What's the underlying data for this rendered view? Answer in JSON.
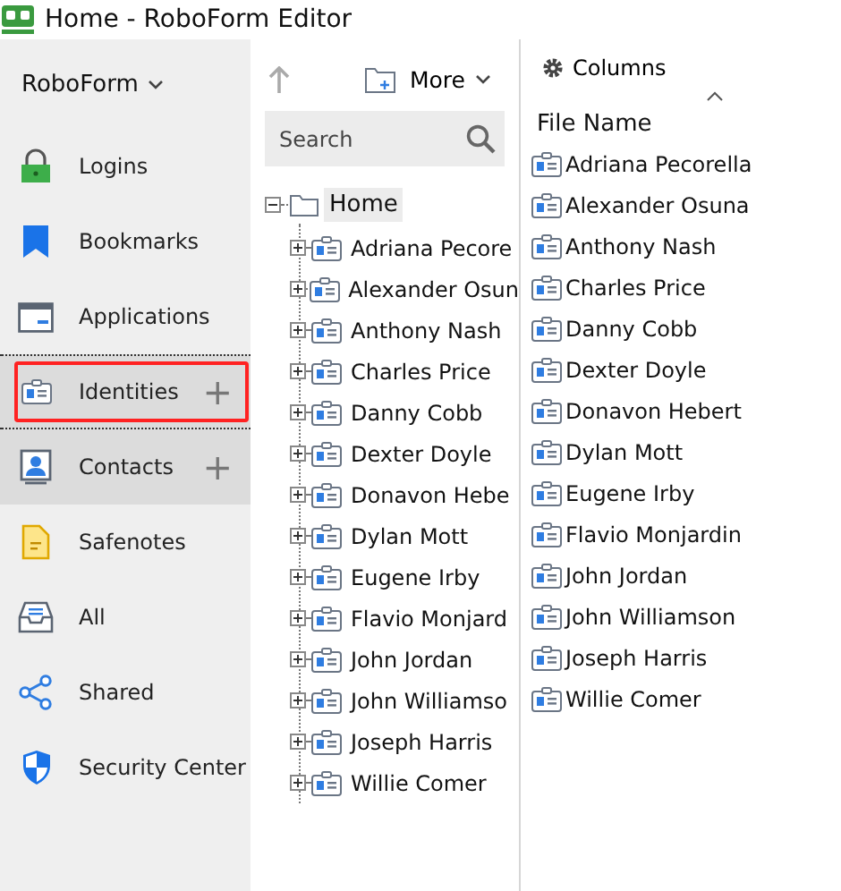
{
  "window": {
    "title": "Home - RoboForm Editor"
  },
  "sidebar": {
    "account": "RoboForm",
    "items": [
      {
        "kind": "logins",
        "label": "Logins",
        "selected": false,
        "hovered": false,
        "add_button": false,
        "annotated": false
      },
      {
        "kind": "bookmarks",
        "label": "Bookmarks",
        "selected": false,
        "hovered": false,
        "add_button": false,
        "annotated": false
      },
      {
        "kind": "applications",
        "label": "Applications",
        "selected": false,
        "hovered": false,
        "add_button": false,
        "annotated": false
      },
      {
        "kind": "identities",
        "label": "Identities",
        "selected": true,
        "hovered": false,
        "add_button": "+",
        "annotated": true
      },
      {
        "kind": "contacts",
        "label": "Contacts",
        "selected": false,
        "hovered": true,
        "add_button": "+",
        "annotated": false
      },
      {
        "kind": "safenotes",
        "label": "Safenotes",
        "selected": false,
        "hovered": false,
        "add_button": false,
        "annotated": false
      },
      {
        "kind": "all",
        "label": "All",
        "selected": false,
        "hovered": false,
        "add_button": false,
        "annotated": false
      },
      {
        "kind": "shared",
        "label": "Shared",
        "selected": false,
        "hovered": false,
        "add_button": false,
        "annotated": false
      },
      {
        "kind": "security",
        "label": "Security Center",
        "selected": false,
        "hovered": false,
        "add_button": false,
        "annotated": false
      }
    ]
  },
  "toolbar": {
    "more": "More"
  },
  "search": {
    "placeholder": "Search"
  },
  "tree": {
    "label": "Home",
    "expanded": true,
    "children": [
      {
        "label": "Adriana Pecore",
        "expanded": false
      },
      {
        "label": "Alexander Osun",
        "expanded": false
      },
      {
        "label": "Anthony Nash",
        "expanded": false
      },
      {
        "label": "Charles Price",
        "expanded": false
      },
      {
        "label": "Danny Cobb",
        "expanded": false
      },
      {
        "label": "Dexter Doyle",
        "expanded": false
      },
      {
        "label": "Donavon Hebe",
        "expanded": false
      },
      {
        "label": "Dylan Mott",
        "expanded": false
      },
      {
        "label": "Eugene Irby",
        "expanded": false
      },
      {
        "label": "Flavio Monjard",
        "expanded": false
      },
      {
        "label": "John Jordan",
        "expanded": false
      },
      {
        "label": "John Williamso",
        "expanded": false
      },
      {
        "label": "Joseph Harris",
        "expanded": false
      },
      {
        "label": "Willie Comer",
        "expanded": false
      }
    ]
  },
  "file_list": {
    "columns_button": "Columns",
    "column": "File Name",
    "rows": [
      "Adriana Pecorella",
      "Alexander Osuna",
      "Anthony Nash",
      "Charles Price",
      "Danny Cobb",
      "Dexter Doyle",
      "Donavon Hebert",
      "Dylan Mott",
      "Eugene Irby",
      "Flavio Monjardin",
      "John Jordan",
      "John Williamson",
      "Joseph Harris",
      "Willie Comer"
    ]
  }
}
